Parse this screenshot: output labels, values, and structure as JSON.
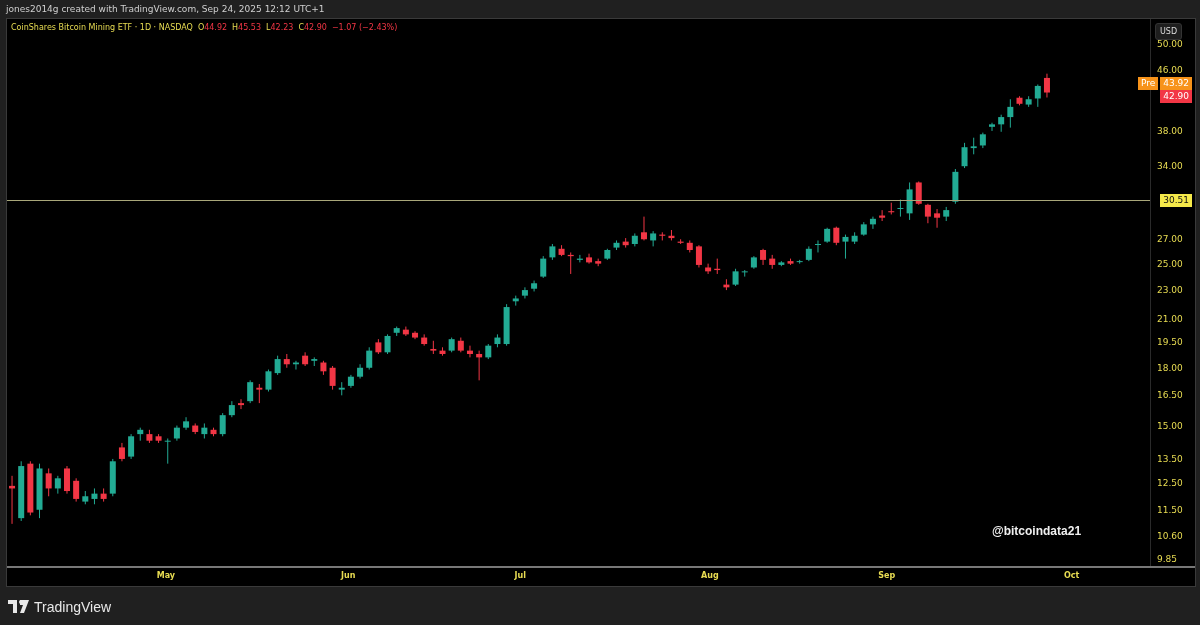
{
  "header": {
    "credit": "jones2014g created with TradingView.com, Sep 24, 2025 12:12 UTC+1"
  },
  "chart": {
    "legend": {
      "title": "CoinShares Bitcoin Mining ETF · 1D · NASDAQ",
      "values": [
        {
          "key": "O",
          "value": "44.92"
        },
        {
          "key": "H",
          "value": "45.53"
        },
        {
          "key": "L",
          "value": "42.23"
        },
        {
          "key": "C",
          "value": "42.90"
        }
      ],
      "change": "−1.07 (−2.43%)"
    },
    "currency_button": "USD",
    "caption": "@bitcoindata21",
    "price_axis": [
      "50.00",
      "46.00",
      "38.00",
      "34.00",
      "27.00",
      "25.00",
      "23.00",
      "21.00",
      "19.50",
      "18.00",
      "16.50",
      "15.00",
      "13.50",
      "12.50",
      "11.50",
      "10.60",
      "9.85"
    ],
    "price_labels": [
      {
        "kind": "price",
        "tag": "Pre",
        "label": "43.92",
        "color": "#f7931a"
      },
      {
        "kind": "price",
        "label": "42.90",
        "color": "#f23645"
      },
      {
        "kind": "hline",
        "label": "30.51",
        "color": "#f5e94a"
      }
    ],
    "time_axis": [
      "May",
      "Jun",
      "Jul",
      "Aug",
      "Sep",
      "Oct"
    ]
  },
  "footer": {
    "brand": "TradingView"
  }
}
